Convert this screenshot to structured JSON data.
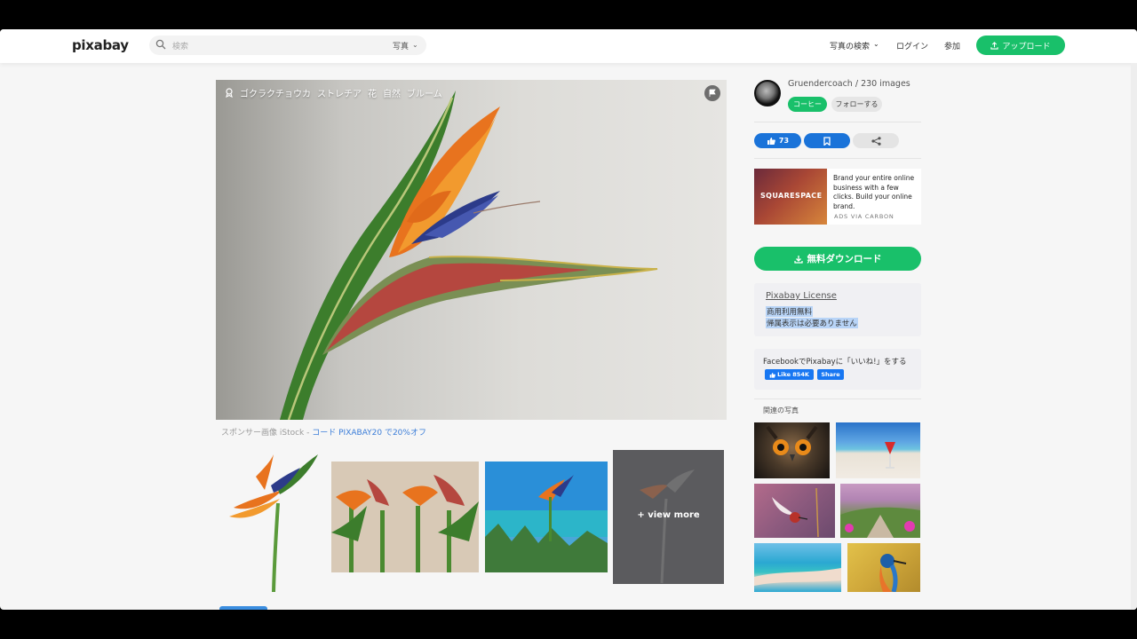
{
  "header": {
    "logo": "pixabay",
    "search_placeholder": "検索",
    "search_type": "写真",
    "nav_explore": "写真の検索",
    "nav_login": "ログイン",
    "nav_join": "参加",
    "upload_label": "アップロード"
  },
  "image": {
    "tags": [
      "ゴクラクチョウカ",
      "ストレチア",
      "花",
      "自然",
      "ブルーム"
    ],
    "sponsor_prefix": "スポンサー画像 iStock - ",
    "sponsor_link": "コード PIXABAY20 で20%オフ"
  },
  "thumbnails": {
    "view_more": "+ view more"
  },
  "author": {
    "name_count": "Gruendercoach / 230 images",
    "coffee_label": "コーヒー",
    "follow_label": "フォローする"
  },
  "actions": {
    "like_count": "73"
  },
  "ad": {
    "brand": "SQUARESPACE",
    "text": "Brand your entire online business with a few clicks. Build your online brand.",
    "via": "ADS VIA CARBON"
  },
  "download": {
    "label": "無料ダウンロード"
  },
  "license": {
    "title": "Pixabay License",
    "line1": "商用利用無料",
    "line2": "帰属表示は必要ありません"
  },
  "facebook": {
    "text": "FacebookでPixabayに「いいね!」をする",
    "like_label": "Like 854K",
    "share_label": "Share"
  },
  "related": {
    "title": "関連の写真"
  },
  "colors": {
    "accent_green": "#19c06a",
    "accent_blue": "#1a73d9"
  }
}
